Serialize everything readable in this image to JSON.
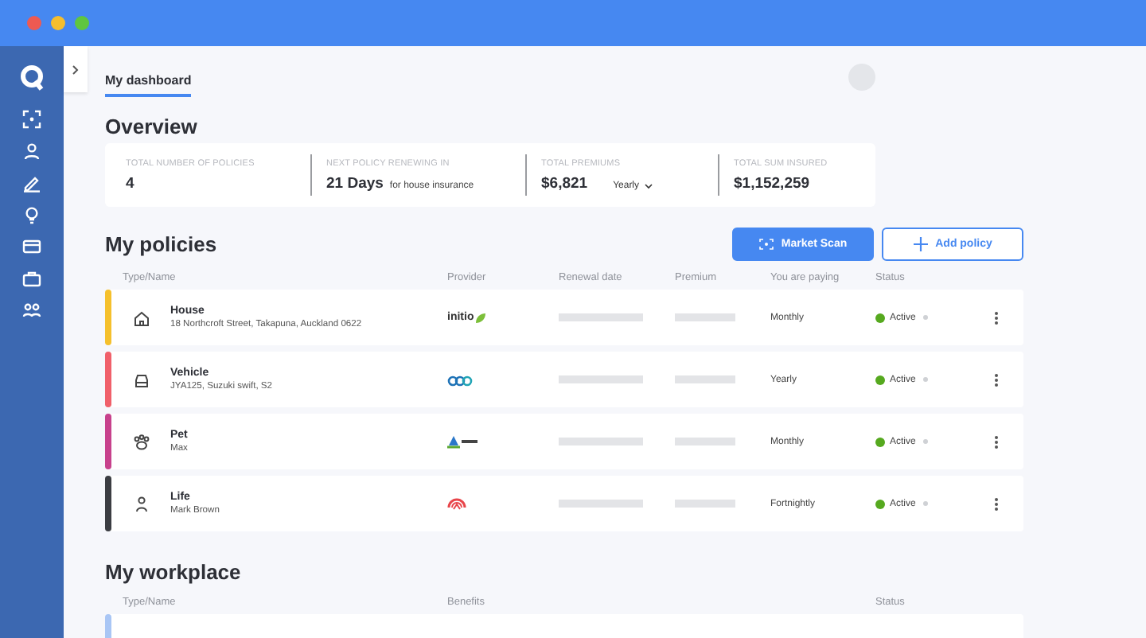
{
  "tabs": [
    {
      "label": "My dashboard",
      "selected": true
    }
  ],
  "overview": {
    "title": "Overview",
    "stats": [
      {
        "kind": "plain",
        "label": "TOTAL NUMBER OF POLICIES",
        "value": "4"
      },
      {
        "kind": "note",
        "label": "NEXT POLICY RENEWING IN",
        "value": "21 Days",
        "note": "for house insurance"
      },
      {
        "kind": "select",
        "label": "TOTAL PREMIUMS",
        "value": "$6,821",
        "option": "Yearly"
      },
      {
        "kind": "plain",
        "label": "TOTAL SUM INSURED",
        "value": "$1,152,259"
      }
    ]
  },
  "policies": {
    "title": "My policies",
    "buttons": [
      {
        "kind": "primary",
        "label": "Market Scan"
      },
      {
        "kind": "outline",
        "label": "Add policy"
      }
    ],
    "columns": [
      "Type/Name",
      "Provider",
      "Renewal date",
      "Premium",
      "You are paying",
      "Status"
    ],
    "rows": [
      {
        "kind": "house",
        "color": "#f5c02c",
        "name": "House",
        "detail": "18 Northcroft Street, Takapuna, Auckland 0622",
        "provider": {
          "kind": "wordmark",
          "text": "initio"
        },
        "paying": "Monthly",
        "status": "Active"
      },
      {
        "kind": "vehicle",
        "color": "#f0606a",
        "name": "Vehicle",
        "detail": "JYA125, Suzuki swift, S2",
        "provider": {
          "kind": "rings"
        },
        "paying": "Yearly",
        "status": "Active"
      },
      {
        "kind": "pet",
        "color": "#c7418c",
        "name": "Pet",
        "detail": "Max",
        "provider": {
          "kind": "tent"
        },
        "paying": "Monthly",
        "status": "Active"
      },
      {
        "kind": "life",
        "color": "#3b3d42",
        "name": "Life",
        "detail": "Mark Brown",
        "provider": {
          "kind": "fan"
        },
        "paying": "Fortnightly",
        "status": "Active"
      }
    ]
  },
  "workplace": {
    "title": "My workplace",
    "columns": [
      "Type/Name",
      "Benefits",
      "Status"
    ],
    "rows": [
      {
        "color": "#a9c6f5"
      }
    ]
  }
}
